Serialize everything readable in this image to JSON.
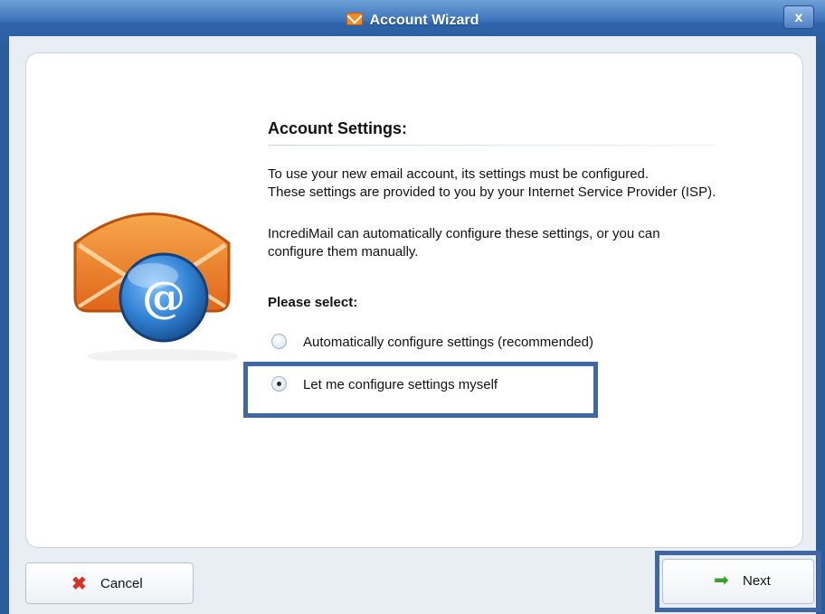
{
  "window": {
    "title": "Account Wizard",
    "close_label": "x"
  },
  "content": {
    "heading": "Account Settings:",
    "paragraph1_line1": "To use your new email account, its settings must be configured.",
    "paragraph1_line2": "These settings are provided to you by your Internet Service Provider (ISP).",
    "paragraph2_line1": "IncrediMail can automatically configure these settings, or you can",
    "paragraph2_line2": "configure them manually.",
    "select_prompt": "Please select:",
    "options": [
      {
        "label": "Automatically configure settings (recommended)",
        "selected": false
      },
      {
        "label": "Let me configure settings myself",
        "selected": true
      }
    ]
  },
  "buttons": {
    "cancel_label": "Cancel",
    "next_label": "Next"
  },
  "icons": {
    "title_icon": "envelope-icon",
    "logo": "email-at-logo",
    "cancel_icon": "x-icon",
    "next_icon": "arrow-right-icon"
  },
  "colors": {
    "titlebar": "#3f77bd",
    "highlight_border": "#3f67a3",
    "envelope_orange": "#f08a24",
    "at_blue": "#2f7fd0"
  }
}
